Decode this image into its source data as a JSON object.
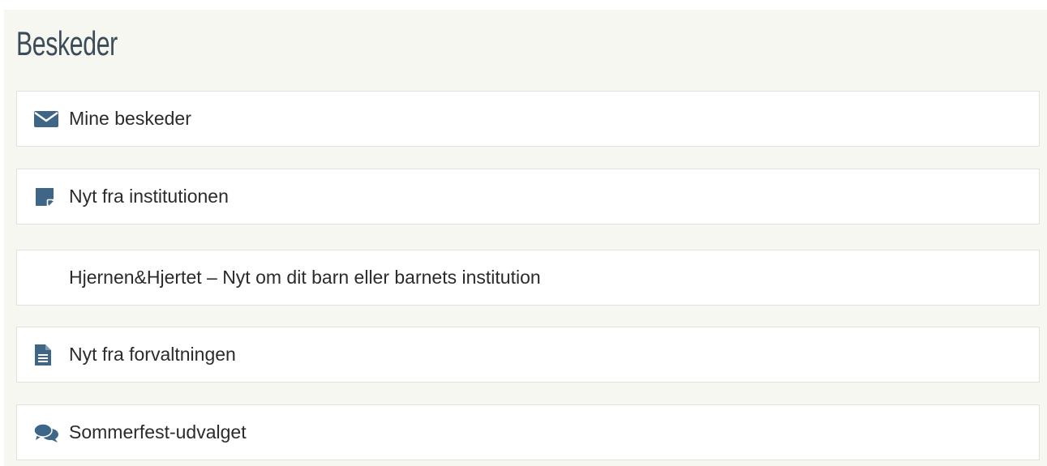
{
  "page": {
    "title": "Beskeder"
  },
  "items": [
    {
      "label": "Mine beskeder",
      "icon": "envelope-icon"
    },
    {
      "label": "Nyt fra institutionen",
      "icon": "sticky-note-icon"
    },
    {
      "label": "Hjernen&Hjertet – Nyt om dit barn eller barnets institution",
      "icon": ""
    },
    {
      "label": "Nyt fra forvaltningen",
      "icon": "document-icon"
    },
    {
      "label": "Sommerfest-udvalget",
      "icon": "comments-icon"
    }
  ],
  "colors": {
    "icon": "#3f6587",
    "heading": "#3c4b59",
    "panel_bg": "#f7f7f2",
    "border": "#e3e3dc"
  }
}
